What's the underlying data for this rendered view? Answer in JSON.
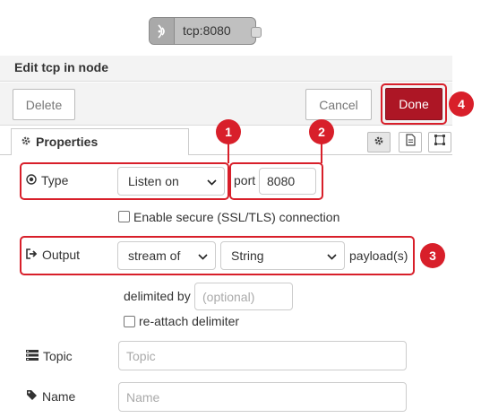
{
  "node": {
    "label": "tcp:8080",
    "icon": "bridge-icon",
    "color": "#c0c0c0"
  },
  "tray": {
    "title": "Edit tcp in node"
  },
  "toolbar": {
    "delete_label": "Delete",
    "cancel_label": "Cancel",
    "done_label": "Done",
    "done_color": "#ad1625"
  },
  "tabs": {
    "properties_label": "Properties",
    "icons": [
      "gear-icon",
      "document-icon",
      "frame-icon"
    ]
  },
  "form": {
    "type_label": "Type",
    "type_value": "Listen on",
    "port_label": "port",
    "port_value": "8080",
    "secure_label": "Enable secure (SSL/TLS) connection",
    "output_label": "Output",
    "output_mode": "stream of",
    "output_type": "String",
    "payload_suffix": "payload(s)",
    "delimited_label": "delimited by",
    "delimited_placeholder": "(optional)",
    "reattach_label": "re-attach delimiter",
    "topic_label": "Topic",
    "topic_placeholder": "Topic",
    "name_label": "Name",
    "name_placeholder": "Name"
  },
  "callouts": {
    "badges": [
      "1",
      "2",
      "3",
      "4"
    ],
    "color": "#d81f2a"
  }
}
